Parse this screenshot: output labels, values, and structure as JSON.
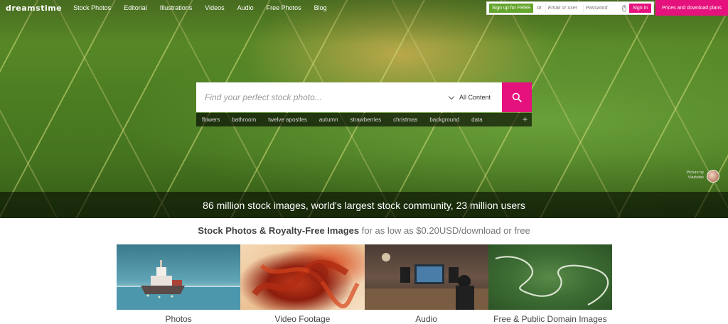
{
  "nav": {
    "logo": "dreamstime",
    "links": [
      "Stock Photos",
      "Editorial",
      "Illustrations",
      "Videos",
      "Audio",
      "Free Photos",
      "Blog"
    ]
  },
  "auth": {
    "signup_label": "Sign up for FREE",
    "or_label": "or",
    "email_placeholder": "Email or user",
    "password_placeholder": "Password",
    "help_glyph": "?",
    "signin_label": "Sign in",
    "pricing_label": "Prices and download plans"
  },
  "search": {
    "placeholder": "Find your perfect stock photo...",
    "content_filter": "All Content",
    "icon": "search-icon",
    "tags": [
      "flowers",
      "bathroom",
      "twelve apostles",
      "autumn",
      "strawberries",
      "christmas",
      "background",
      "data"
    ],
    "more_tags_glyph": "+"
  },
  "credit": {
    "line1": "Picture by",
    "line2": "Vladvitek"
  },
  "tagline": "86 million stock images, world's largest stock community, 23 million users",
  "subheading": {
    "strong": "Stock Photos & Royalty-Free Images",
    "rest": " for as low as $0.20USD/download or free"
  },
  "categories": [
    {
      "label": "Photos"
    },
    {
      "label": "Video Footage"
    },
    {
      "label": "Audio"
    },
    {
      "label": "Free & Public Domain Images"
    }
  ],
  "colors": {
    "accent_pink": "#e5127d",
    "signup_green": "#64a52b"
  }
}
